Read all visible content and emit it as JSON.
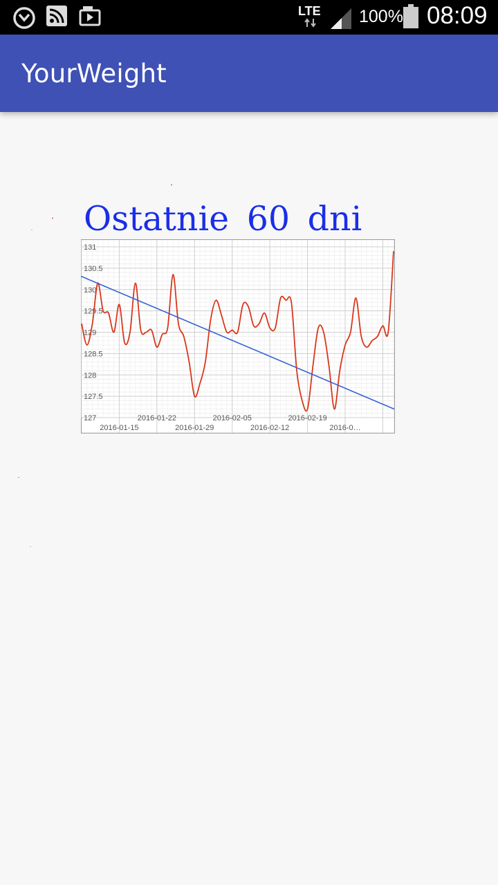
{
  "status_bar": {
    "network": "LTE",
    "battery": "100%",
    "time": "08:09",
    "icons": [
      "alarm-icon",
      "rss-feed-icon",
      "media-player-icon",
      "data-arrows-icon",
      "signal-icon",
      "battery-icon"
    ]
  },
  "app_bar": {
    "title": "YourWeight",
    "color": "#3f51b5"
  },
  "chart": {
    "heading": "Ostatnie 60 dni",
    "heading_color": "#1a2ee8",
    "series_color": "#d9361b",
    "trend_color": "#3563d6"
  },
  "chart_data": {
    "type": "line",
    "title": "",
    "xlabel": "",
    "ylabel": "",
    "ylim": [
      127,
      131
    ],
    "y_ticks": [
      "131",
      "130.5",
      "130",
      "129.5",
      "129",
      "128.5",
      "128",
      "127.5",
      "127"
    ],
    "x_tick_labels": [
      "2016-01-15",
      "2016-01-22",
      "2016-01-29",
      "2016-02-05",
      "2016-02-12",
      "2016-02-19",
      "2016-0…"
    ],
    "grid": true,
    "legend": "none",
    "series": [
      {
        "values": [
          129.2,
          128.7,
          129.2,
          130.15,
          129.5,
          129.45,
          129.0,
          129.65,
          128.75,
          129.0,
          130.15,
          129.05,
          129.0,
          129.05,
          128.65,
          128.95,
          129.1,
          130.35,
          129.2,
          128.9,
          128.3,
          127.5,
          127.8,
          128.3,
          129.3,
          129.75,
          129.4,
          129.0,
          129.05,
          129.0,
          129.65,
          129.6,
          129.15,
          129.2,
          129.45,
          129.1,
          129.1,
          129.8,
          129.75,
          129.7,
          128.1,
          127.4,
          127.2,
          128.2,
          129.1,
          129.0,
          128.2,
          127.2,
          128.1,
          128.7,
          129.0,
          129.8,
          128.9,
          128.65,
          128.8,
          128.9,
          129.15,
          129.0,
          130.9
        ]
      },
      {
        "type": "trend",
        "start": 130.15,
        "end": 127.2
      }
    ]
  }
}
